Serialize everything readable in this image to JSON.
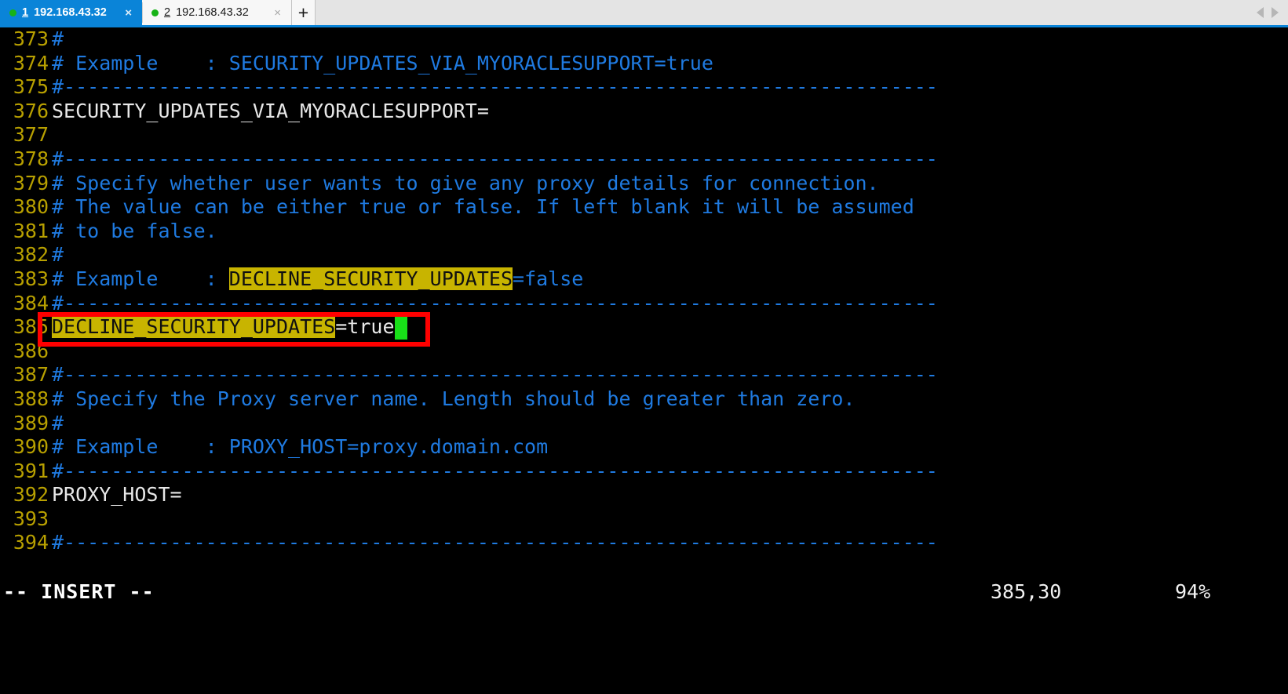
{
  "window": {
    "kind": "terminal-emulator",
    "background": "#000000"
  },
  "tabbar": {
    "background": "#e4e4e4",
    "active_color": "#0a84d8",
    "status_dot_color": "#17b317",
    "tabs": [
      {
        "index": "1",
        "title": "192.168.43.32",
        "close_label": "×",
        "active": true,
        "status_dot": "connected"
      },
      {
        "index": "2",
        "title": "192.168.43.32",
        "close_label": "×",
        "active": false,
        "status_dot": "connected"
      }
    ],
    "new_tab_label": "+",
    "scroll_left_icon": "chevron-left-icon",
    "scroll_right_icon": "chevron-right-icon"
  },
  "editor": {
    "line_number_color": "#b8a000",
    "comment_color": "#1f7ae0",
    "text_color": "#e8e8e8",
    "search_highlight_bg": "#c8b400",
    "cursor_color": "#18e018",
    "search_term": "DECLINE_SECURITY_UPDATES",
    "lines": [
      {
        "num": "373",
        "segments": [
          {
            "t": "#",
            "s": "cmt"
          }
        ]
      },
      {
        "num": "374",
        "segments": [
          {
            "t": "# Example    : SECURITY_UPDATES_VIA_MYORACLESUPPORT=true",
            "s": "cmt"
          }
        ]
      },
      {
        "num": "375",
        "segments": [
          {
            "t": "#--------------------------------------------------------------------------",
            "s": "cmt"
          }
        ]
      },
      {
        "num": "376",
        "segments": [
          {
            "t": "SECURITY_UPDATES_VIA_MYORACLESUPPORT=",
            "s": "plain"
          }
        ]
      },
      {
        "num": "377",
        "segments": []
      },
      {
        "num": "378",
        "segments": [
          {
            "t": "#--------------------------------------------------------------------------",
            "s": "cmt"
          }
        ]
      },
      {
        "num": "379",
        "segments": [
          {
            "t": "# Specify whether user wants to give any proxy details for connection.",
            "s": "cmt"
          }
        ]
      },
      {
        "num": "380",
        "segments": [
          {
            "t": "# The value can be either true or false. If left blank it will be assumed",
            "s": "cmt"
          }
        ]
      },
      {
        "num": "381",
        "segments": [
          {
            "t": "# to be false.",
            "s": "cmt"
          }
        ]
      },
      {
        "num": "382",
        "segments": [
          {
            "t": "#",
            "s": "cmt"
          }
        ]
      },
      {
        "num": "383",
        "segments": [
          {
            "t": "# Example    : ",
            "s": "cmt"
          },
          {
            "t": "DECLINE_SECURITY_UPDATES",
            "s": "hl"
          },
          {
            "t": "=false",
            "s": "cmt"
          }
        ]
      },
      {
        "num": "384",
        "segments": [
          {
            "t": "#--------------------------------------------------------------------------",
            "s": "cmt"
          }
        ]
      },
      {
        "num": "385",
        "segments": [
          {
            "t": "DECLINE_SECURITY_UPDATES",
            "s": "hl"
          },
          {
            "t": "=true",
            "s": "plain"
          },
          {
            "t": " ",
            "s": "cursor"
          }
        ]
      },
      {
        "num": "386",
        "segments": []
      },
      {
        "num": "387",
        "segments": [
          {
            "t": "#--------------------------------------------------------------------------",
            "s": "cmt"
          }
        ]
      },
      {
        "num": "388",
        "segments": [
          {
            "t": "# Specify the Proxy server name. Length should be greater than zero.",
            "s": "cmt"
          }
        ]
      },
      {
        "num": "389",
        "segments": [
          {
            "t": "#",
            "s": "cmt"
          }
        ]
      },
      {
        "num": "390",
        "segments": [
          {
            "t": "# Example    : PROXY_HOST=proxy.domain.com",
            "s": "cmt"
          }
        ]
      },
      {
        "num": "391",
        "segments": [
          {
            "t": "#--------------------------------------------------------------------------",
            "s": "cmt"
          }
        ]
      },
      {
        "num": "392",
        "segments": [
          {
            "t": "PROXY_HOST=",
            "s": "plain"
          }
        ]
      },
      {
        "num": "393",
        "segments": []
      },
      {
        "num": "394",
        "segments": [
          {
            "t": "#--------------------------------------------------------------------------",
            "s": "cmt"
          }
        ]
      }
    ]
  },
  "statusline": {
    "mode": "-- INSERT --",
    "ruler": "385,30",
    "percent": "94%"
  },
  "annotation": {
    "shape": "rectangle",
    "color": "#ff0000",
    "target_line": "385"
  }
}
